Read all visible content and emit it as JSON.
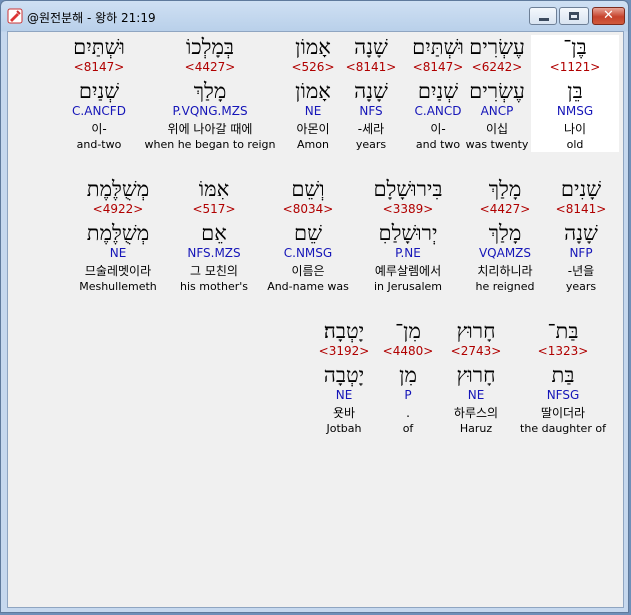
{
  "window": {
    "title": "@원전분해 - 왕하 21:19",
    "buttons": {
      "minimize": "–",
      "maximize": "□",
      "close": "✕"
    }
  },
  "rows": [
    [
      {
        "surface": "בֶּן־",
        "strong": "<1121>",
        "lexeme": "בֵּן",
        "morph": "NMSG",
        "korean": "나이",
        "english": "old",
        "highlight": true
      },
      {
        "surface": "עֶשְׂרִים",
        "strong": "<6242>",
        "lexeme": "עֶשְׂרִים",
        "morph": "ANCP",
        "korean": "이십",
        "english": "was twenty"
      },
      {
        "surface": "וּשְׁתַּיִם",
        "strong": "<8147>",
        "lexeme": "שְׁנַיִם",
        "morph": "C.ANCD",
        "korean": "이-",
        "english": "and two"
      },
      {
        "surface": "שָׁנָה",
        "strong": "<8141>",
        "lexeme": "שָׁנָה",
        "morph": "NFS",
        "korean": "-세라",
        "english": "years"
      },
      {
        "surface": "אָמוֹן",
        "strong": "<526>",
        "lexeme": "אָמוֹן",
        "morph": "NE",
        "korean": "아몬이",
        "english": "Amon"
      },
      {
        "surface": "בְּמָלְכוֹ",
        "strong": "<4427>",
        "lexeme": "מָלַךְ",
        "morph": "P.VQNG.MZS",
        "korean": "위에 나아갈 때에",
        "english": "when he began to reign"
      },
      {
        "surface": "וּשְׁתַּיִם",
        "strong": "<8147>",
        "lexeme": "שְׁנַיִם",
        "morph": "C.ANCFD",
        "korean": "이-",
        "english": "and-two"
      }
    ],
    [
      {
        "surface": "שָׁנִים",
        "strong": "<8141>",
        "lexeme": "שָׁנָה",
        "morph": "NFP",
        "korean": "-년을",
        "english": "years"
      },
      {
        "surface": "מָלַךְ",
        "strong": "<4427>",
        "lexeme": "מָלַךְ",
        "morph": "VQAMZS",
        "korean": "치리하니라",
        "english": "he reigned"
      },
      {
        "surface": "בִּירוּשָׁלָם",
        "strong": "<3389>",
        "lexeme": "יְרוּשָׁלַםִ",
        "morph": "P.NE",
        "korean": "예루살렘에서",
        "english": "in Jerusalem"
      },
      {
        "surface": "וְשֵׁם",
        "strong": "<8034>",
        "lexeme": "שֵׁם",
        "morph": "C.NMSG",
        "korean": "이름은",
        "english": "And-name was"
      },
      {
        "surface": "אִמּוֹ",
        "strong": "<517>",
        "lexeme": "אֵם",
        "morph": "NFS.MZS",
        "korean": "그 모친의",
        "english": "his mother's"
      },
      {
        "surface": "מְשֻׁלֶּמֶת",
        "strong": "<4922>",
        "lexeme": "מְשֻׁלֶּמֶת",
        "morph": "NE",
        "korean": "므술레멧이라",
        "english": "Meshullemeth"
      }
    ],
    [
      {
        "surface": "בַּת־",
        "strong": "<1323>",
        "lexeme": "בַּת",
        "morph": "NFSG",
        "korean": "딸이더라",
        "english": "the daughter of"
      },
      {
        "surface": "חָרוּץ",
        "strong": "<2743>",
        "lexeme": "חָרוּץ",
        "morph": "NE",
        "korean": "하루스의",
        "english": "Haruz"
      },
      {
        "surface": "מִן־",
        "strong": "<4480>",
        "lexeme": "מִן",
        "morph": "P",
        "korean": ".",
        "english": "of"
      },
      {
        "surface": "יָטְבָה׃",
        "strong": "<3192>",
        "lexeme": "יָטְבָה",
        "morph": "NE",
        "korean": "욧바",
        "english": "Jotbah"
      }
    ]
  ]
}
